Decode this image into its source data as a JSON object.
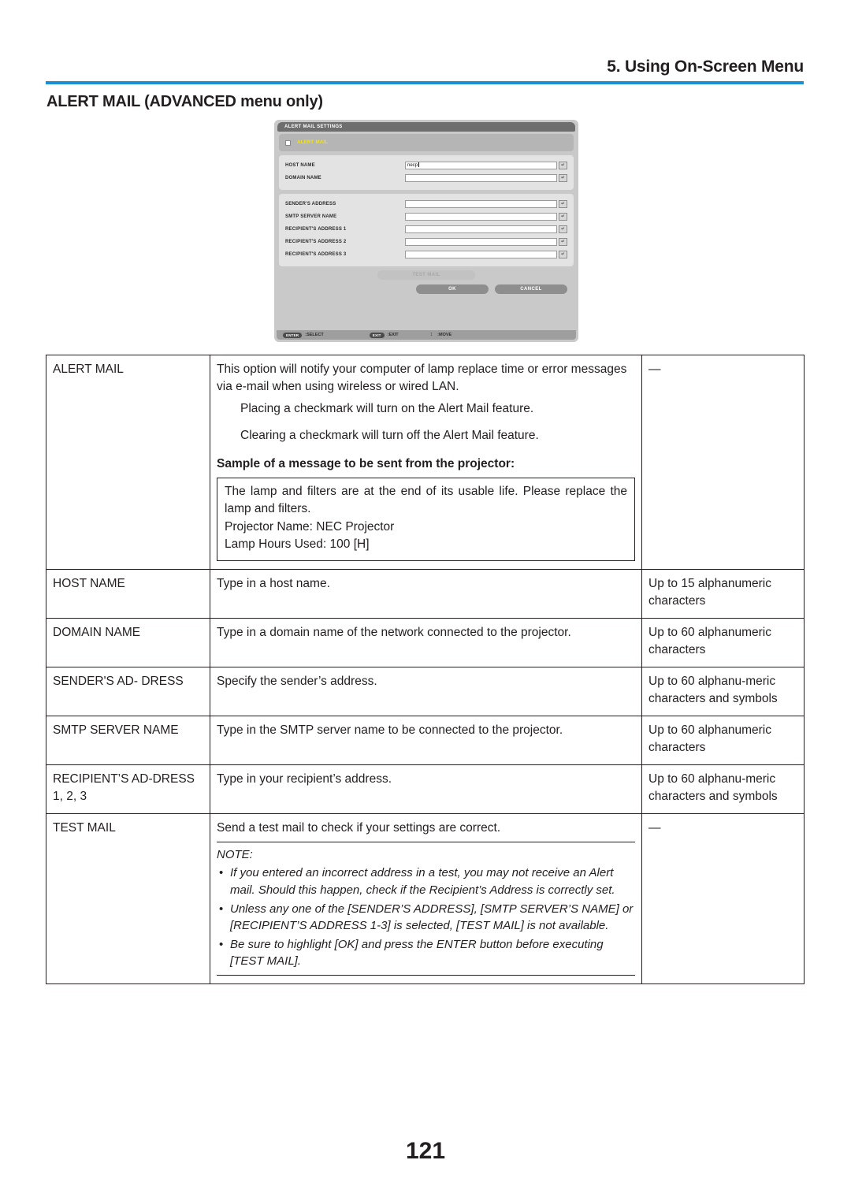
{
  "header": {
    "chapter_title": "5. Using On-Screen Menu",
    "rule_color": "#1b8fd4"
  },
  "section": {
    "title": "ALERT MAIL (ADVANCED menu only)"
  },
  "osd_dialog": {
    "title": "ALERT MAIL SETTINGS",
    "checkbox_label": "ALERT MAIL",
    "checkbox_label_color": "#f2e313",
    "checkbox_checked": false,
    "fields": [
      {
        "label": "HOST NAME",
        "value": "necp",
        "enter_icon": "↵"
      },
      {
        "label": "DOMAIN NAME",
        "value": "",
        "enter_icon": "↵"
      },
      {
        "label": "SENDER'S ADDRESS",
        "value": "",
        "enter_icon": "↵"
      },
      {
        "label": "SMTP SERVER NAME",
        "value": "",
        "enter_icon": "↵"
      },
      {
        "label": "RECIPIENT'S ADDRESS 1",
        "value": "",
        "enter_icon": "↵"
      },
      {
        "label": "RECIPIENT'S ADDRESS 2",
        "value": "",
        "enter_icon": "↵"
      },
      {
        "label": "RECIPIENT'S ADDRESS 3",
        "value": "",
        "enter_icon": "↵"
      }
    ],
    "test_mail_button": "TEST MAIL",
    "ok_button": "OK",
    "cancel_button": "CANCEL",
    "status_bar": {
      "select_key": "ENTER",
      "select_label": ":SELECT",
      "exit_key": "EXIT",
      "exit_label": ":EXIT",
      "move_arrows": "↕",
      "move_label": ":MOVE"
    }
  },
  "table": {
    "rows": [
      {
        "name": "ALERT MAIL",
        "desc_p1": "This option will notify your computer of lamp replace time or error messages via e-mail when using wireless or wired LAN.",
        "desc_indent1": "Placing a checkmark will turn on the Alert Mail feature.",
        "desc_indent2": "Clearing a checkmark will turn off the Alert Mail feature.",
        "sample_heading": "Sample of a message to be sent from the projector:",
        "sample_line1": "The lamp and filters are at the end of its usable life. Please replace the lamp and filters.",
        "sample_line2": "Projector Name: NEC Projector",
        "sample_line3": "Lamp Hours Used: 100 [H]",
        "limit": "—"
      },
      {
        "name": "HOST NAME",
        "desc": "Type in a host name.",
        "limit": "Up to 15 alphanumeric characters"
      },
      {
        "name": "DOMAIN NAME",
        "desc": "Type in a domain name of the network connected to the projector.",
        "limit": "Up to 60 alphanumeric characters"
      },
      {
        "name": "SENDER'S AD-\nDRESS",
        "desc": "Specify the sender’s address.",
        "limit": "Up to 60 alphanu-meric characters and symbols"
      },
      {
        "name": "SMTP SERVER NAME",
        "desc": "Type in the SMTP server name to be connected to the projector.",
        "limit": "Up to 60 alphanumeric characters"
      },
      {
        "name": "RECIPIENT’S AD-DRESS 1, 2, 3",
        "desc": "Type in your recipient’s address.",
        "limit": "Up to 60 alphanu-meric characters and symbols"
      },
      {
        "name": "TEST MAIL",
        "desc": "Send a test mail to check if your settings are correct.",
        "note_title": "NOTE:",
        "notes": [
          "If you entered an incorrect address in a test, you may not receive an Alert mail. Should this happen, check if the Recipient’s Address is correctly set.",
          "Unless any one of the [SENDER’S ADDRESS], [SMTP SERVER’S NAME] or [RECIPIENT’S ADDRESS 1-3] is selected, [TEST MAIL] is not available.",
          "Be sure to highlight [OK] and press the ENTER button before executing [TEST MAIL]."
        ],
        "limit": "—"
      }
    ]
  },
  "footer": {
    "page_number": "121"
  }
}
